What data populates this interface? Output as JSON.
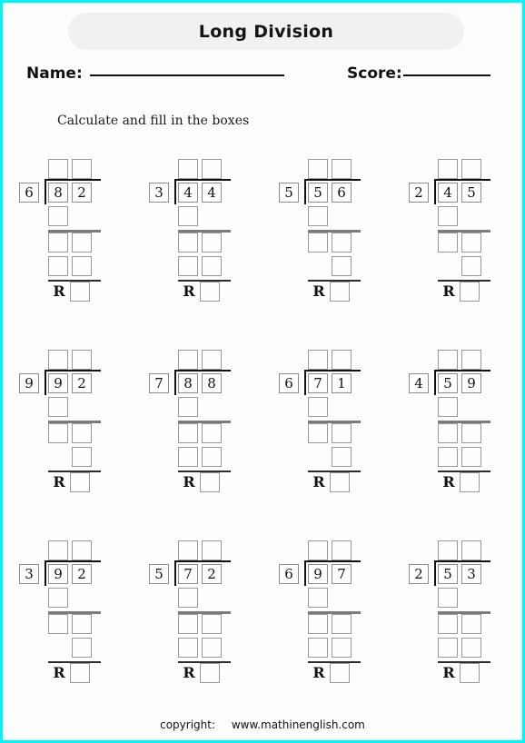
{
  "page": {
    "border_color": "#00f5f5",
    "background": "#fdfdfd"
  },
  "header": {
    "title": "Long Division",
    "pill_color": "#f1f1f1",
    "name_label": "Name:",
    "score_label": "Score:",
    "name_value": "",
    "score_value": ""
  },
  "instruction": "Calculate and fill in the boxes",
  "problems": [
    {
      "index": 1,
      "divisor": "6",
      "dividend_digits": [
        "8",
        "2"
      ],
      "quotient_boxes": 2,
      "sub1_boxes": 1,
      "bringdown_boxes": 2,
      "sub2_boxes": 2,
      "sub2_align": "left",
      "remainder_label": "R"
    },
    {
      "index": 2,
      "divisor": "3",
      "dividend_digits": [
        "4",
        "4"
      ],
      "quotient_boxes": 2,
      "sub1_boxes": 1,
      "bringdown_boxes": 2,
      "sub2_boxes": 2,
      "sub2_align": "left",
      "remainder_label": "R"
    },
    {
      "index": 3,
      "divisor": "5",
      "dividend_digits": [
        "5",
        "6"
      ],
      "quotient_boxes": 2,
      "sub1_boxes": 1,
      "bringdown_boxes": 2,
      "sub2_boxes": 1,
      "sub2_align": "right",
      "remainder_label": "R"
    },
    {
      "index": 4,
      "divisor": "2",
      "dividend_digits": [
        "4",
        "5"
      ],
      "quotient_boxes": 2,
      "sub1_boxes": 1,
      "bringdown_boxes": 2,
      "sub2_boxes": 1,
      "sub2_align": "right",
      "remainder_label": "R"
    },
    {
      "index": 5,
      "divisor": "9",
      "dividend_digits": [
        "9",
        "2"
      ],
      "quotient_boxes": 2,
      "sub1_boxes": 1,
      "bringdown_boxes": 2,
      "sub2_boxes": 1,
      "sub2_align": "right",
      "remainder_label": "R"
    },
    {
      "index": 6,
      "divisor": "7",
      "dividend_digits": [
        "8",
        "8"
      ],
      "quotient_boxes": 2,
      "sub1_boxes": 1,
      "bringdown_boxes": 2,
      "sub2_boxes": 2,
      "sub2_align": "left",
      "remainder_label": "R"
    },
    {
      "index": 7,
      "divisor": "6",
      "dividend_digits": [
        "7",
        "1"
      ],
      "quotient_boxes": 2,
      "sub1_boxes": 1,
      "bringdown_boxes": 2,
      "sub2_boxes": 1,
      "sub2_align": "right",
      "remainder_label": "R"
    },
    {
      "index": 8,
      "divisor": "4",
      "dividend_digits": [
        "5",
        "9"
      ],
      "quotient_boxes": 2,
      "sub1_boxes": 1,
      "bringdown_boxes": 2,
      "sub2_boxes": 2,
      "sub2_align": "left",
      "remainder_label": "R"
    },
    {
      "index": 9,
      "divisor": "3",
      "dividend_digits": [
        "9",
        "2"
      ],
      "quotient_boxes": 2,
      "sub1_boxes": 1,
      "bringdown_boxes": 2,
      "sub2_boxes": 1,
      "sub2_align": "right",
      "remainder_label": "R"
    },
    {
      "index": 10,
      "divisor": "5",
      "dividend_digits": [
        "7",
        "2"
      ],
      "quotient_boxes": 2,
      "sub1_boxes": 1,
      "bringdown_boxes": 2,
      "sub2_boxes": 2,
      "sub2_align": "left",
      "remainder_label": "R"
    },
    {
      "index": 11,
      "divisor": "6",
      "dividend_digits": [
        "9",
        "7"
      ],
      "quotient_boxes": 2,
      "sub1_boxes": 1,
      "bringdown_boxes": 2,
      "sub2_boxes": 2,
      "sub2_align": "left",
      "remainder_label": "R"
    },
    {
      "index": 12,
      "divisor": "2",
      "dividend_digits": [
        "5",
        "3"
      ],
      "quotient_boxes": 2,
      "sub1_boxes": 1,
      "bringdown_boxes": 2,
      "sub2_boxes": 2,
      "sub2_align": "left",
      "remainder_label": "R"
    }
  ],
  "footer": {
    "copyright_label": "copyright:",
    "site": "www.mathinenglish.com"
  }
}
